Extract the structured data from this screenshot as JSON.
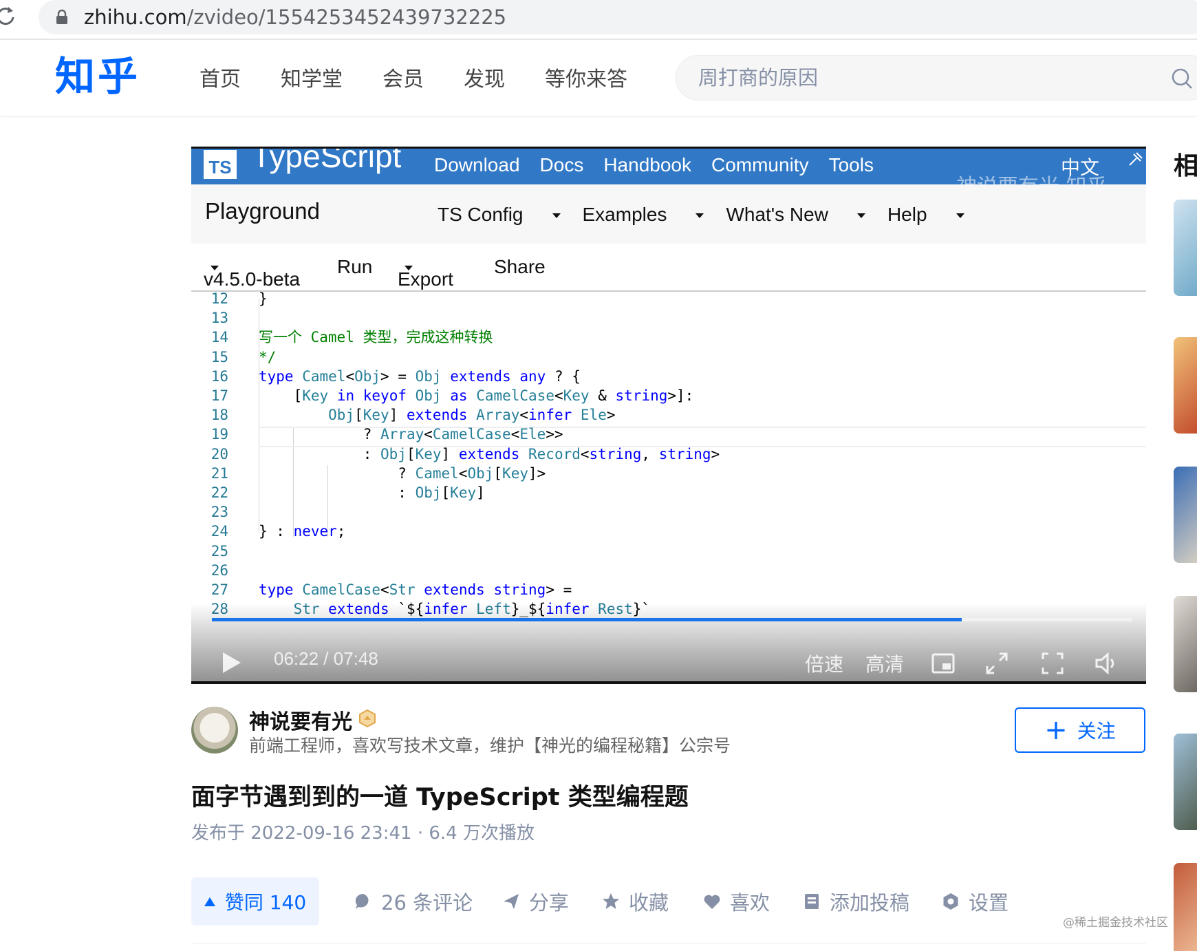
{
  "browser": {
    "url_host": "zhihu.com",
    "url_path": "/zvideo/1554253452439732225"
  },
  "header": {
    "logo": "知乎",
    "nav": [
      "首页",
      "知学堂",
      "会员",
      "发现",
      "等你来答"
    ],
    "search_placeholder": "周打商的原因"
  },
  "video": {
    "ts_nav": {
      "logo": "TS",
      "title": "TypeScript",
      "links": [
        "Download",
        "Docs",
        "Handbook",
        "Community",
        "Tools"
      ],
      "lang": "中文",
      "watermark": "神说要有光 知乎"
    },
    "playground": {
      "title": "Playground",
      "menus": [
        "TS Config",
        "Examples",
        "What's New",
        "Help"
      ]
    },
    "toolbar": {
      "version": "v4.5.0-beta",
      "run": "Run",
      "export": "Export",
      "share": "Share"
    },
    "code_lines": [
      {
        "n": "12",
        "t": "}"
      },
      {
        "n": "13",
        "t": ""
      },
      {
        "n": "14",
        "t": "写一个 Camel 类型，完成这种转换"
      },
      {
        "n": "15",
        "t": "*/"
      },
      {
        "n": "16",
        "t": "type Camel<Obj> = Obj extends any ? {"
      },
      {
        "n": "17",
        "t": "    [Key in keyof Obj as CamelCase<Key & string>]:"
      },
      {
        "n": "18",
        "t": "        Obj[Key] extends Array<infer Ele>"
      },
      {
        "n": "19",
        "t": "            ? Array<CamelCase<Ele>>"
      },
      {
        "n": "20",
        "t": "            : Obj[Key] extends Record<string, string>"
      },
      {
        "n": "21",
        "t": "                ? Camel<Obj[Key]>"
      },
      {
        "n": "22",
        "t": "                : Obj[Key]"
      },
      {
        "n": "23",
        "t": ""
      },
      {
        "n": "24",
        "t": "} : never;"
      },
      {
        "n": "25",
        "t": ""
      },
      {
        "n": "26",
        "t": ""
      },
      {
        "n": "27",
        "t": "type CamelCase<Str extends string> ="
      },
      {
        "n": "28",
        "t": "    Str extends `${infer Left}_${infer Rest}`"
      }
    ],
    "player": {
      "time": "06:22 / 07:48",
      "progress": 0.815,
      "speed": "倍速",
      "quality": "高清",
      "accent": "#1a73e8"
    }
  },
  "author": {
    "name": "神说要有光",
    "bio": "前端工程师，喜欢写技术文章，维护【神光的编程秘籍】公宗号",
    "follow": "关注"
  },
  "post": {
    "title": "面字节遇到到的一道 TypeScript 类型编程题",
    "meta": "发布于 2022-09-16 23:41 · 6.4 万次播放"
  },
  "actions": {
    "vote": "赞同 140",
    "comments": "26 条评论",
    "share": "分享",
    "collect": "收藏",
    "like": "喜欢",
    "contribute": "添加投稿",
    "settings": "设置"
  },
  "sidebar": {
    "title": "相"
  },
  "watermark": "@稀土掘金技术社区",
  "colors": {
    "brand": "#0066ff",
    "ts_blue": "#3178c6"
  }
}
